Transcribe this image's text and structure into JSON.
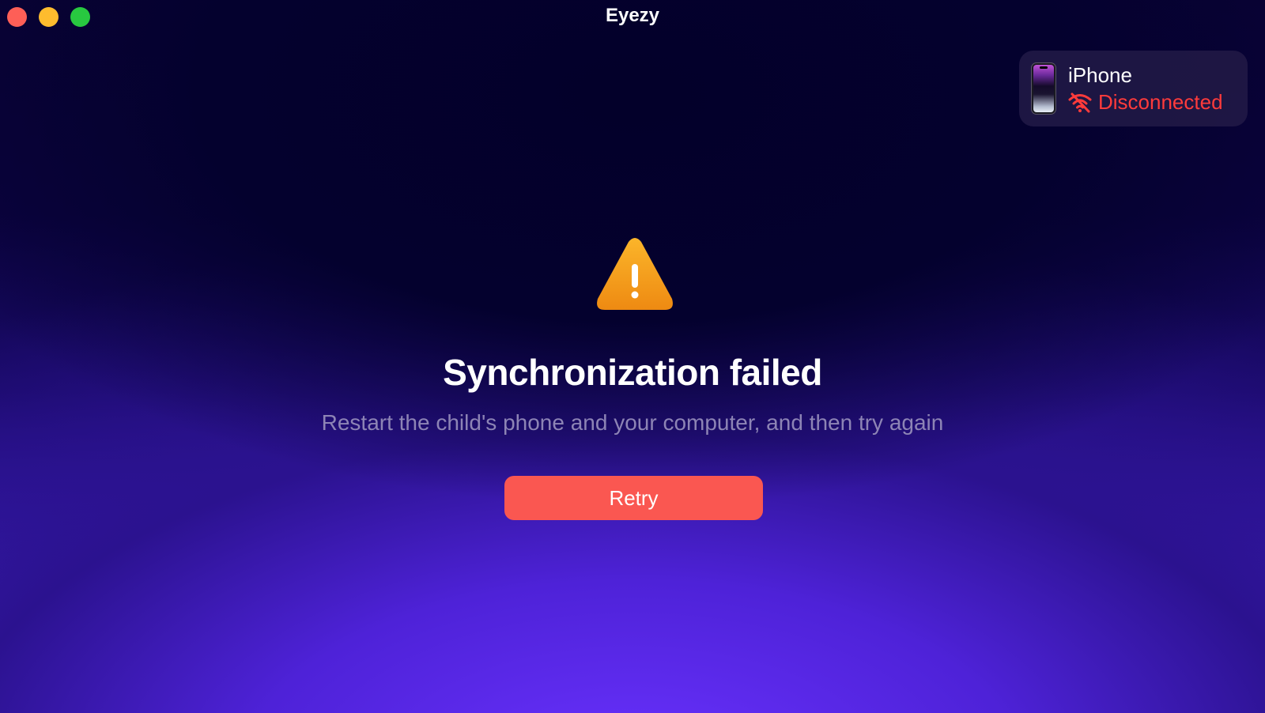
{
  "window": {
    "title": "Eyezy",
    "controls": {
      "close_color": "#fe5f57",
      "minimize_color": "#febc2e",
      "maximize_color": "#28c840"
    }
  },
  "device": {
    "name": "iPhone",
    "status": "Disconnected",
    "status_color": "#ff3b3b",
    "icons": [
      "iphone-icon",
      "wifi-off-icon"
    ]
  },
  "alert": {
    "icon": "warning-icon",
    "icon_color": "#f5a31a",
    "title": "Synchronization failed",
    "message": "Restart the child's phone and your computer, and then try again"
  },
  "actions": {
    "retry_label": "Retry",
    "retry_color": "#fa5751"
  }
}
